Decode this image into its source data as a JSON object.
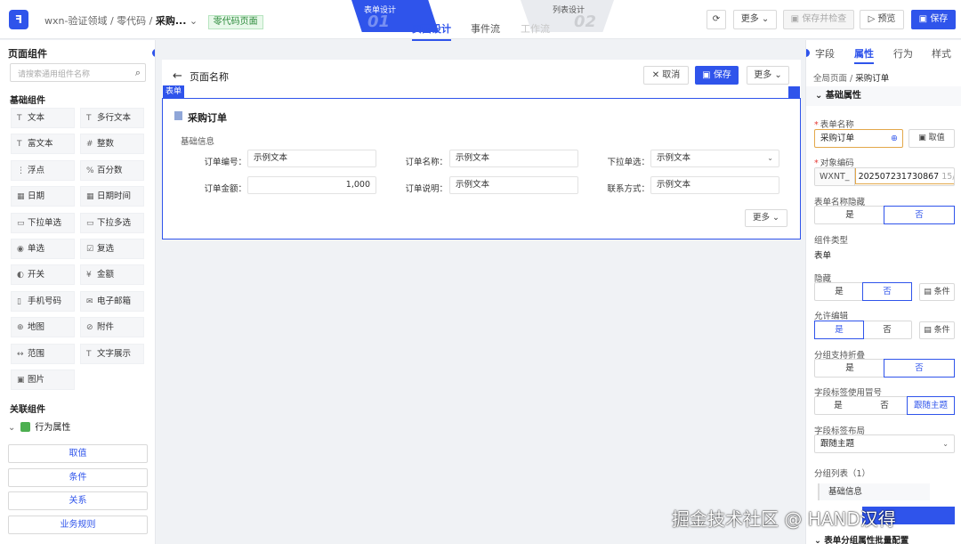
{
  "topbar": {
    "breadcrumb": "wxn-验证领域 / 零代码 / ",
    "current_page": "采购...",
    "dropdown_arrow": "⌄",
    "page_tag": "零代码页面",
    "step1_label": "表单设计",
    "step1_num": "01",
    "step2_label": "列表设计",
    "step2_num": "02",
    "tabs": [
      "页面设计",
      "事件流",
      "工作流"
    ],
    "refresh_glyph": "⟳",
    "more": "更多 ⌄",
    "save_check": "保存并检查",
    "preview": "预览",
    "save": "保存"
  },
  "left_panel": {
    "title": "页面组件",
    "search_placeholder": "请搜索通用组件名称",
    "basic_section": "基础组件",
    "components": [
      {
        "label": "文本",
        "icon": "T"
      },
      {
        "label": "多行文本",
        "icon": "T"
      },
      {
        "label": "富文本",
        "icon": "T"
      },
      {
        "label": "整数",
        "icon": "#"
      },
      {
        "label": "浮点",
        "icon": "⋮"
      },
      {
        "label": "百分数",
        "icon": "%"
      },
      {
        "label": "日期",
        "icon": "▦"
      },
      {
        "label": "日期时间",
        "icon": "▦"
      },
      {
        "label": "下拉单选",
        "icon": "▭"
      },
      {
        "label": "下拉多选",
        "icon": "▭"
      },
      {
        "label": "单选",
        "icon": "◉"
      },
      {
        "label": "复选",
        "icon": "☑"
      },
      {
        "label": "开关",
        "icon": "◐"
      },
      {
        "label": "金额",
        "icon": "¥"
      },
      {
        "label": "手机号码",
        "icon": "▯"
      },
      {
        "label": "电子邮箱",
        "icon": "✉"
      },
      {
        "label": "地图",
        "icon": "⊕"
      },
      {
        "label": "附件",
        "icon": "⊘"
      },
      {
        "label": "范围",
        "icon": "↔"
      },
      {
        "label": "文字展示",
        "icon": "T"
      },
      {
        "label": "图片",
        "icon": "▣"
      }
    ],
    "related_section": "关联组件",
    "behavior_title": "行为属性",
    "behavior_buttons": [
      "取值",
      "条件",
      "关系",
      "业务规则"
    ]
  },
  "canvas": {
    "back_arrow": "←",
    "page_name": "页面名称",
    "cancel": "✕ 取消",
    "save": "保存",
    "more": "更多 ⌄",
    "form_tag": "表单",
    "form_title": "采购订单",
    "group_title": "基础信息",
    "fields": [
      {
        "label": "订单编号：",
        "value": "示例文本"
      },
      {
        "label": "订单名称：",
        "value": "示例文本"
      },
      {
        "label": "下拉单选：",
        "value": "示例文本",
        "dropdown": "⌄"
      },
      {
        "label": "订单金额：",
        "value": "1,000"
      },
      {
        "label": "订单说明：",
        "value": "示例文本"
      },
      {
        "label": "联系方式：",
        "value": "示例文本"
      }
    ],
    "form_more": "更多 ⌄"
  },
  "right_panel": {
    "tabs": [
      "字段",
      "属性",
      "行为",
      "样式"
    ],
    "active_tab": "属性",
    "breadcrumb_root": "全局页面 / ",
    "breadcrumb_current": "采购订单",
    "section": "⌄  基础属性",
    "form_name_label": "表单名称",
    "form_name_value": "采购订单",
    "globe": "⊕",
    "fetch_button": "取值",
    "object_code_label": "对象编码",
    "object_code_prefix": "WXNT_",
    "object_code_value": "202507231730867",
    "object_code_count": "15/51",
    "hide_name_label": "表单名称隐藏",
    "yes": "是",
    "no": "否",
    "component_type_label": "组件类型",
    "component_type_value": "表单",
    "hidden_label": "隐藏",
    "condition": "条件",
    "editable_label": "允许编辑",
    "collapse_label": "分组支持折叠",
    "colon_label": "字段标签使用冒号",
    "follow_theme": "跟随主题",
    "layout_label": "字段标签布局",
    "layout_value": "跟随主题",
    "group_list_label": "分组列表（1）",
    "group_item": "基础信息",
    "bottom_cut": "表单分组属性批量配置"
  },
  "watermark": "掘金技术社区 @ HAND汉得"
}
